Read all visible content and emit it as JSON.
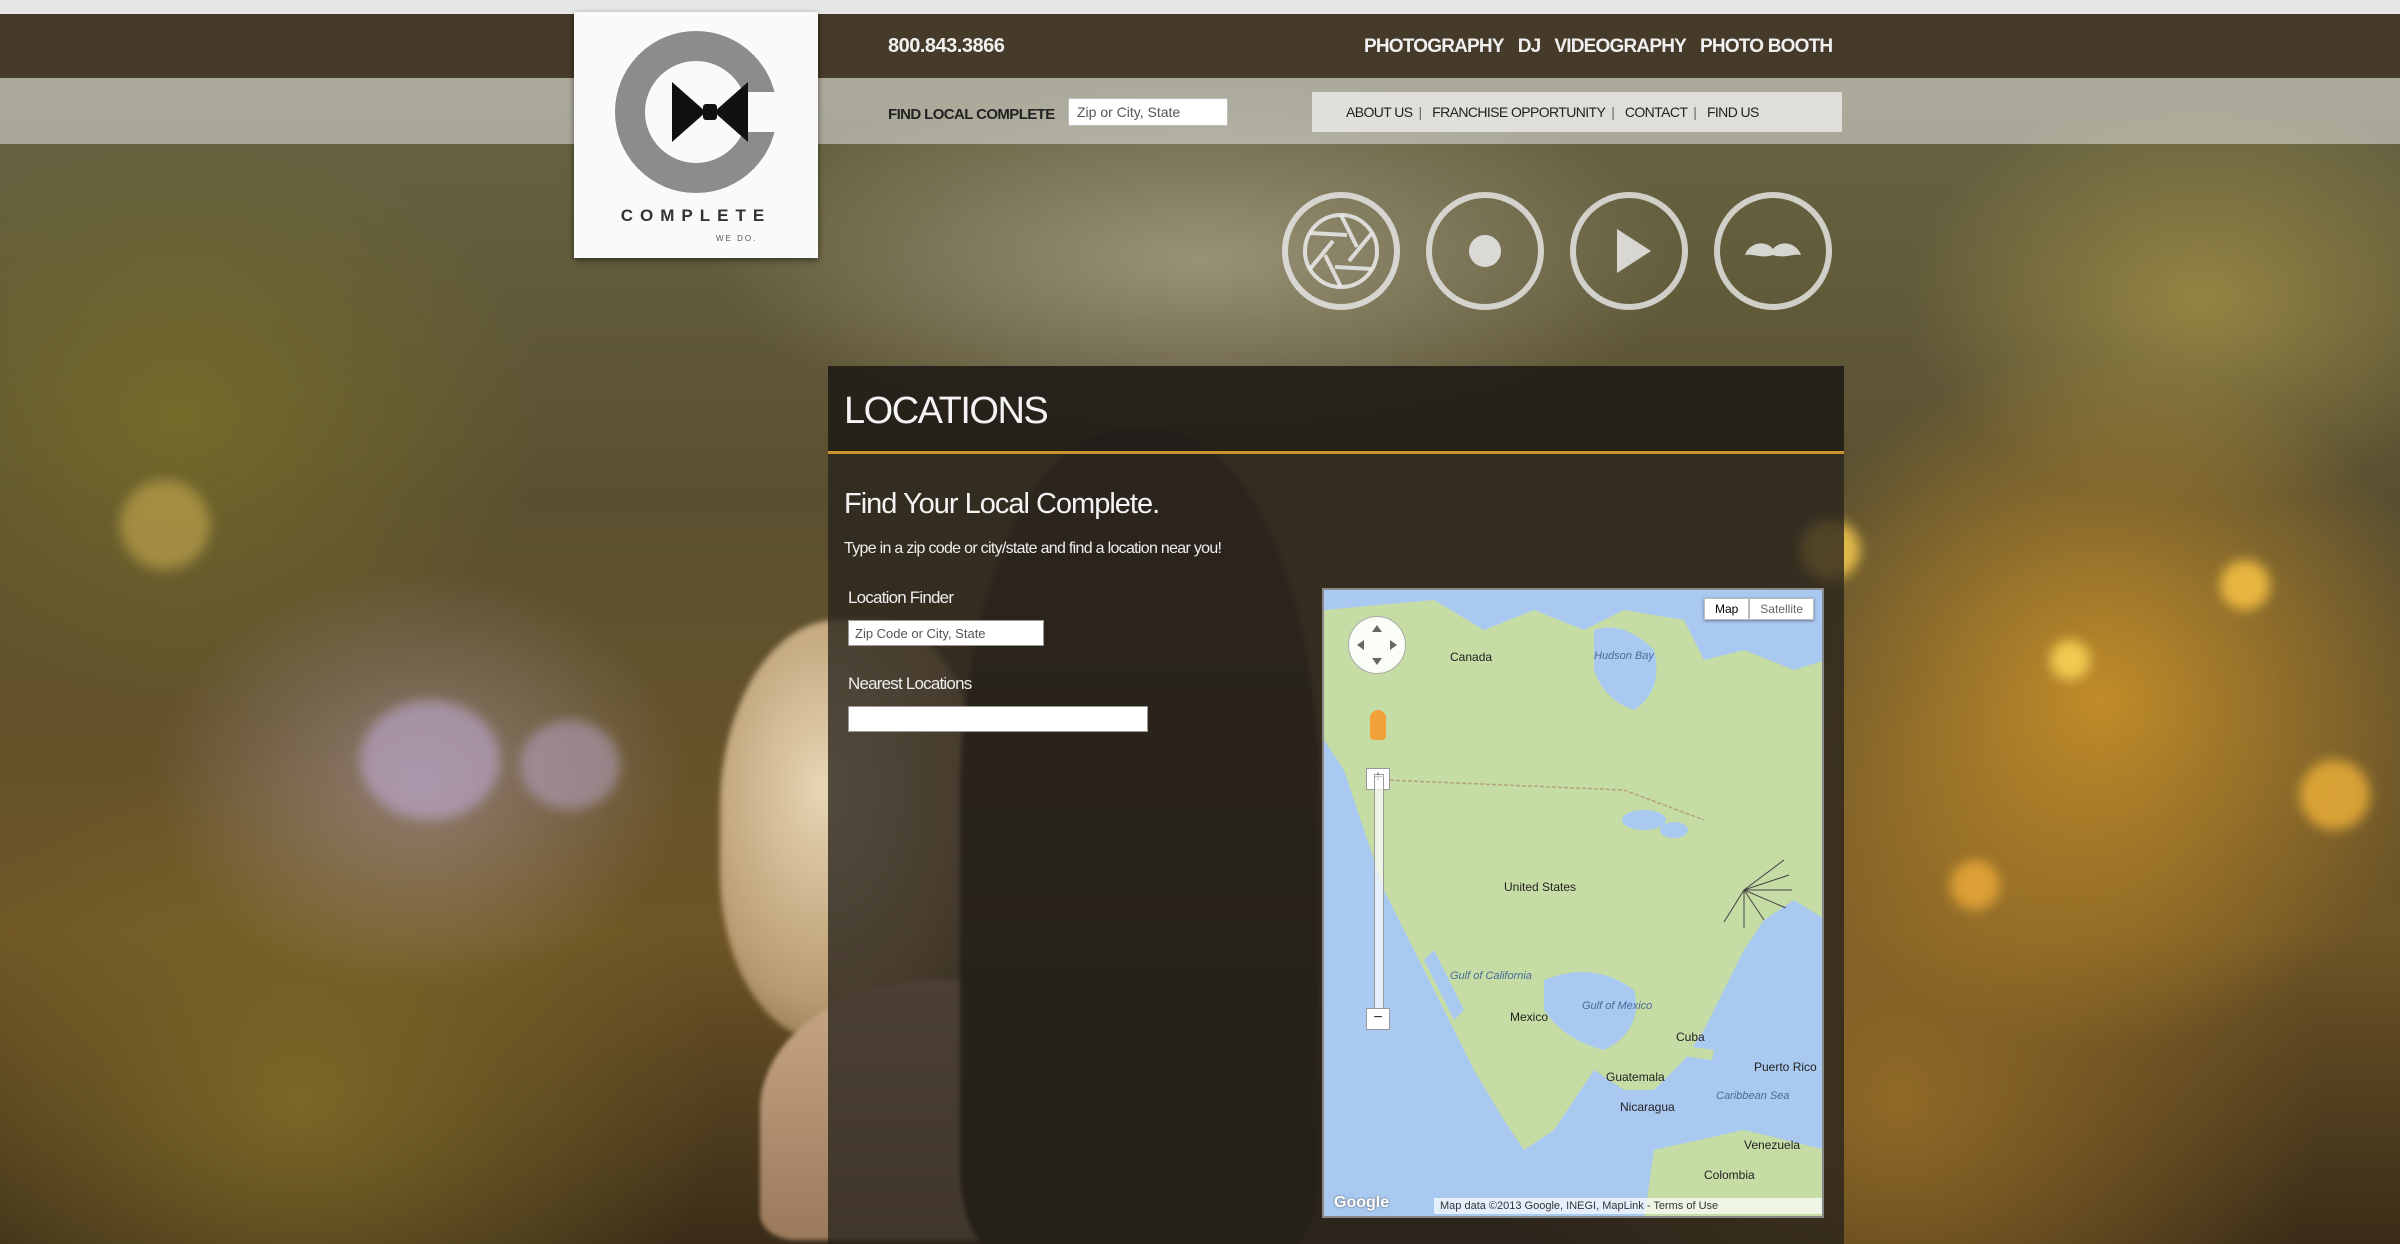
{
  "header": {
    "phone": "800.843.3866",
    "main_nav": [
      "PHOTOGRAPHY",
      "DJ",
      "VIDEOGRAPHY",
      "PHOTO BOOTH"
    ],
    "find_local_label": "FIND LOCAL COMPLETE",
    "find_local_placeholder": "Zip or City, State",
    "sub_nav": [
      "ABOUT US",
      "FRANCHISE OPPORTUNITY",
      "CONTACT",
      "FIND US"
    ],
    "sub_nav_separator": "|"
  },
  "logo": {
    "word": "COMPLETE",
    "tagline": "WE DO."
  },
  "services": [
    {
      "icon": "aperture-icon"
    },
    {
      "icon": "record-icon"
    },
    {
      "icon": "play-icon"
    },
    {
      "icon": "mustache-icon"
    }
  ],
  "locations": {
    "title": "LOCATIONS",
    "heading": "Find Your Local Complete.",
    "subheading": "Type in a zip code or city/state and find a location near you!",
    "finder_label": "Location Finder",
    "finder_placeholder": "Zip Code or City, State",
    "nearest_label": "Nearest Locations",
    "nearest_value": ""
  },
  "map": {
    "type_map": "Map",
    "type_satellite": "Satellite",
    "labels": {
      "canada": "Canada",
      "hudson_bay": "Hudson Bay",
      "united_states": "United States",
      "mexico": "Mexico",
      "gulf_california": "Gulf of California",
      "gulf_mexico": "Gulf of Mexico",
      "cuba": "Cuba",
      "caribbean": "Caribbean Sea",
      "venezuela": "Venezuela",
      "colombia": "Colombia",
      "guatemala": "Guatemala",
      "nicaragua": "Nicaragua",
      "puerto_rico": "Puerto Rico"
    },
    "attribution": "Map data ©2013 Google, INEGI, MapLink - Terms of Use",
    "google": "Google",
    "zoom_in": "+",
    "zoom_out": "−"
  },
  "colors": {
    "accent": "#c8932a",
    "panel": "#28221c",
    "map_water": "#a9c9f1",
    "map_land": "#c6dca5"
  }
}
